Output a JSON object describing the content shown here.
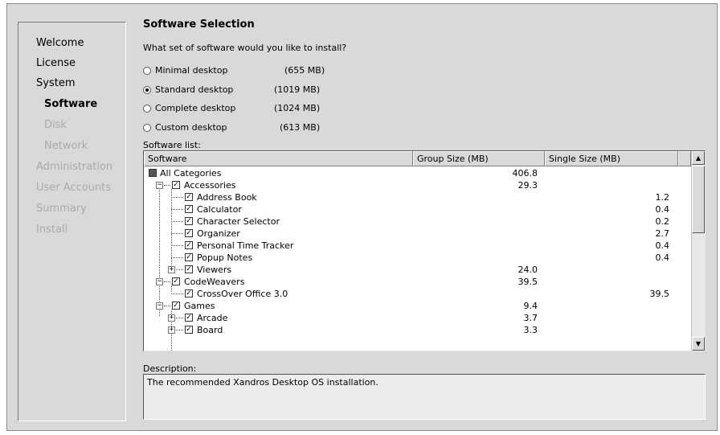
{
  "steps": [
    {
      "label": "Welcome",
      "state": "done"
    },
    {
      "label": "License",
      "state": "done"
    },
    {
      "label": "System",
      "state": "done"
    },
    {
      "label": "Software",
      "state": "current"
    },
    {
      "label": "Disk",
      "state": "future"
    },
    {
      "label": "Network",
      "state": "future"
    },
    {
      "label": "Administration",
      "state": "future"
    },
    {
      "label": "User Accounts",
      "state": "future"
    },
    {
      "label": "Summary",
      "state": "future"
    },
    {
      "label": "Install",
      "state": "future"
    }
  ],
  "main": {
    "title": "Software Selection",
    "question": "What set of software would you like to install?",
    "options": [
      {
        "label": "Minimal desktop",
        "size": "(655 MB)",
        "checked": false
      },
      {
        "label": "Standard desktop",
        "size": "(1019 MB)",
        "checked": true
      },
      {
        "label": "Complete desktop",
        "size": "(1024 MB)",
        "checked": false
      },
      {
        "label": "Custom desktop",
        "size": "(613 MB)",
        "checked": false
      }
    ],
    "list_label": "Software list:",
    "columns": [
      "Software",
      "Group Size (MB)",
      "Single Size (MB)"
    ],
    "rows": [
      {
        "name": "All Categories",
        "group": "406.8",
        "single": "",
        "level": 0
      },
      {
        "name": "Accessories",
        "group": "29.3",
        "single": "",
        "level": 1
      },
      {
        "name": "Address Book",
        "group": "",
        "single": "1.2",
        "level": 2
      },
      {
        "name": "Calculator",
        "group": "",
        "single": "0.4",
        "level": 2
      },
      {
        "name": "Character Selector",
        "group": "",
        "single": "0.2",
        "level": 2
      },
      {
        "name": "Organizer",
        "group": "",
        "single": "2.7",
        "level": 2
      },
      {
        "name": "Personal Time Tracker",
        "group": "",
        "single": "0.4",
        "level": 2
      },
      {
        "name": "Popup Notes",
        "group": "",
        "single": "0.4",
        "level": 2
      },
      {
        "name": "Viewers",
        "group": "24.0",
        "single": "",
        "level": 2
      },
      {
        "name": "CodeWeavers",
        "group": "39.5",
        "single": "",
        "level": 1
      },
      {
        "name": "CrossOver Office 3.0",
        "group": "",
        "single": "39.5",
        "level": 2
      },
      {
        "name": "Games",
        "group": "9.4",
        "single": "",
        "level": 1
      },
      {
        "name": "Arcade",
        "group": "3.7",
        "single": "",
        "level": 2
      },
      {
        "name": "Board",
        "group": "3.3",
        "single": "",
        "level": 2
      }
    ],
    "description_label": "Description:",
    "description": "The recommended Xandros Desktop OS installation."
  }
}
